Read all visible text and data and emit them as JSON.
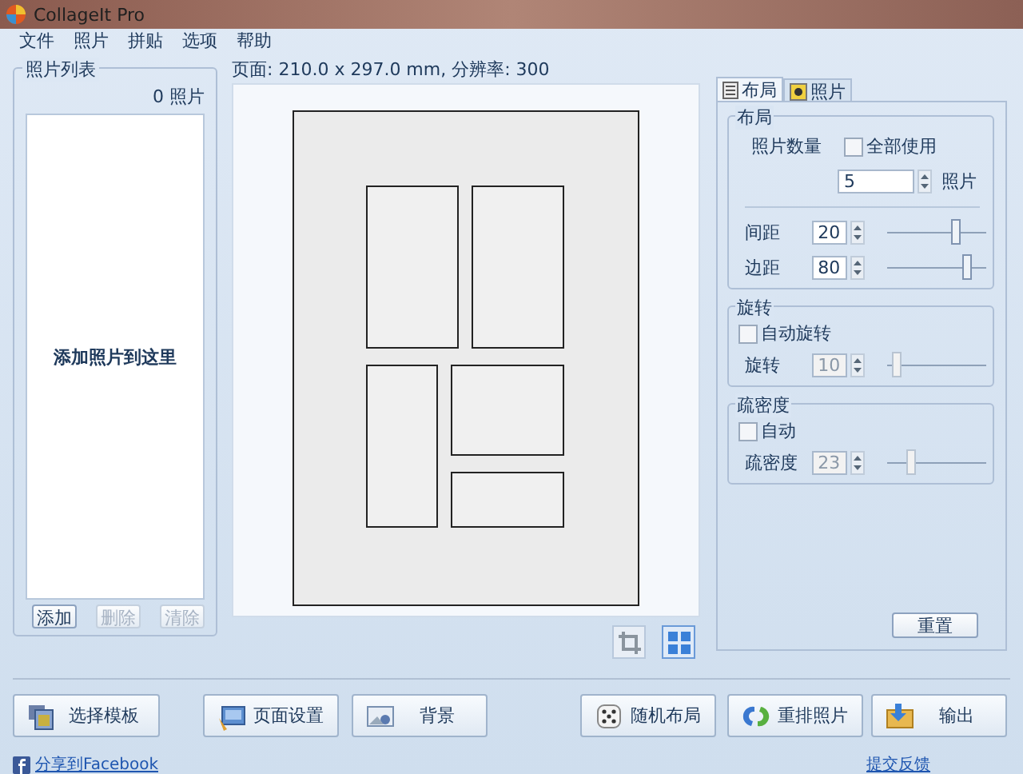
{
  "window": {
    "title": "CollageIt Pro"
  },
  "menu": [
    "文件",
    "照片",
    "拼贴",
    "选项",
    "帮助"
  ],
  "photo_list": {
    "title": "照片列表",
    "count": "0 照片",
    "placeholder": "添加照片到这里",
    "buttons": [
      {
        "label": "添加",
        "disabled": false
      },
      {
        "label": "删除",
        "disabled": true
      },
      {
        "label": "清除",
        "disabled": true
      }
    ]
  },
  "page_info": "页面: 210.0 x 297.0 mm, 分辨率: 300",
  "canvas_tools": [
    {
      "kind": "crop",
      "disabled": true
    },
    {
      "kind": "fit",
      "disabled": false
    }
  ],
  "tabs": [
    {
      "label": "布局",
      "selected": true,
      "kind": "layout"
    },
    {
      "label": "照片",
      "selected": false,
      "kind": "photo"
    }
  ],
  "groups": [
    {
      "title": "布局",
      "items": [
        {
          "kind": "count",
          "label": "照片数量",
          "checkbox": {
            "label": "全部使用",
            "checked": false
          },
          "value": "5",
          "unit": "照片"
        },
        {
          "kind": "spin",
          "label": "间距",
          "value": "20",
          "level": 0.7,
          "disabled": false
        },
        {
          "kind": "spin",
          "label": "边距",
          "value": "80",
          "level": 0.8,
          "disabled": false
        }
      ]
    },
    {
      "title": "旋转",
      "items": [
        {
          "kind": "checkbox",
          "label": "自动旋转",
          "checked": false
        },
        {
          "kind": "spin",
          "label": "旋转",
          "value": "10",
          "level": 0.1,
          "disabled": true
        }
      ]
    },
    {
      "title": "疏密度",
      "items": [
        {
          "kind": "checkbox",
          "label": "自动",
          "checked": false
        },
        {
          "kind": "spin",
          "label": "疏密度",
          "value": "23",
          "level": 0.25,
          "disabled": true
        }
      ]
    }
  ],
  "reset_button": "重置",
  "bottom_buttons": [
    {
      "label": "选择模板",
      "kind": "template"
    },
    {
      "label": "页面设置",
      "kind": "page"
    },
    {
      "label": "背景",
      "kind": "background"
    },
    {
      "label": "随机布局",
      "kind": "random"
    },
    {
      "label": "重排照片",
      "kind": "shuffle"
    },
    {
      "label": "输出",
      "kind": "export"
    }
  ],
  "share_link": "分享到Facebook",
  "feedback_link": "提交反馈"
}
